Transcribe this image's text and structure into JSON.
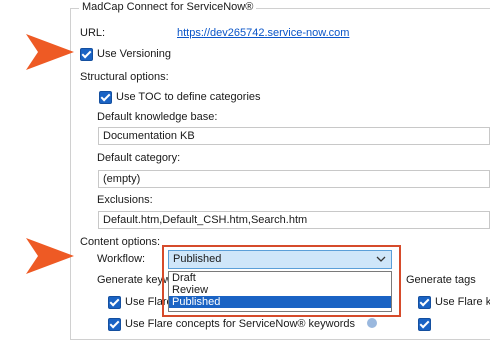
{
  "groupbox": {
    "title": "MadCap Connect for ServiceNow®"
  },
  "url": {
    "label": "URL:",
    "value": "https://dev265742.service-now.com"
  },
  "versioning": {
    "label": "Use Versioning",
    "checked": true
  },
  "structural": {
    "title": "Structural options:",
    "toc": {
      "label": "Use TOC to define categories",
      "checked": true
    },
    "kb_label": "Default knowledge base:",
    "kb_value": "Documentation KB",
    "cat_label": "Default category:",
    "cat_value": "(empty)",
    "excl_label": "Exclusions:",
    "excl_value": "Default.htm,Default_CSH.htm,Search.htm"
  },
  "content": {
    "title": "Content options:",
    "workflow_label": "Workflow:",
    "workflow_value": "Published",
    "workflow_options": [
      "Draft",
      "Review",
      "Published"
    ],
    "gen_keywords_label": "Generate keyw",
    "gen_tags_label": "Generate tags",
    "use_flare_left": "Use Flare",
    "use_flare_right": "Use Flare keyw",
    "use_concepts": "Use Flare concepts for ServiceNow® keywords"
  },
  "colors": {
    "accent": "#1a63c4",
    "callout": "#ee5a24",
    "highlight": "#d64b2b"
  }
}
